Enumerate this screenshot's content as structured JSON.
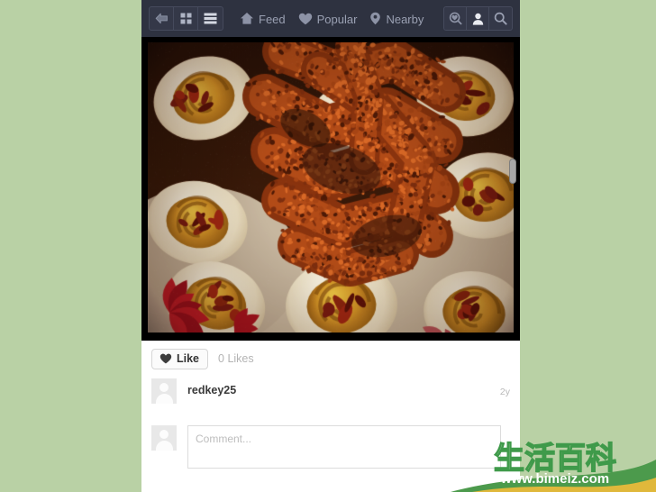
{
  "theme": {
    "page_background": "#b9d1a5",
    "topbar_background": "#2e3240",
    "topbar_text": "#9aa0b2",
    "panel_background": "#ffffff",
    "photo_frame": "#000000",
    "muted_text": "#b4b4b4"
  },
  "topbar": {
    "left_buttons": [
      {
        "name": "back-icon",
        "label": "Back"
      },
      {
        "name": "grid-icon",
        "label": "Grid"
      },
      {
        "name": "list-icon",
        "label": "List"
      }
    ],
    "nav_links": [
      {
        "icon": "home-icon",
        "label": "Feed"
      },
      {
        "icon": "heart-icon",
        "label": "Popular"
      },
      {
        "icon": "location-pin-icon",
        "label": "Nearby"
      }
    ],
    "right_buttons": [
      {
        "name": "heart-search-icon",
        "label": "Liked"
      },
      {
        "name": "person-icon",
        "label": "Profile"
      },
      {
        "name": "search-icon",
        "label": "Search"
      }
    ]
  },
  "photo": {
    "alt": "Deviled eggs topped with bacon bits arranged around fried breaded chicken strips on a white floral plate",
    "scrollbar_visible": true
  },
  "post": {
    "like_label": "Like",
    "like_icon": "heart-icon",
    "like_count": "0 Likes",
    "author": "redkey25",
    "timestamp": "2y"
  },
  "comment": {
    "placeholder": "Comment...",
    "value": ""
  },
  "watermark": {
    "title": "生活百科",
    "url": "www.bimeiz.com"
  }
}
